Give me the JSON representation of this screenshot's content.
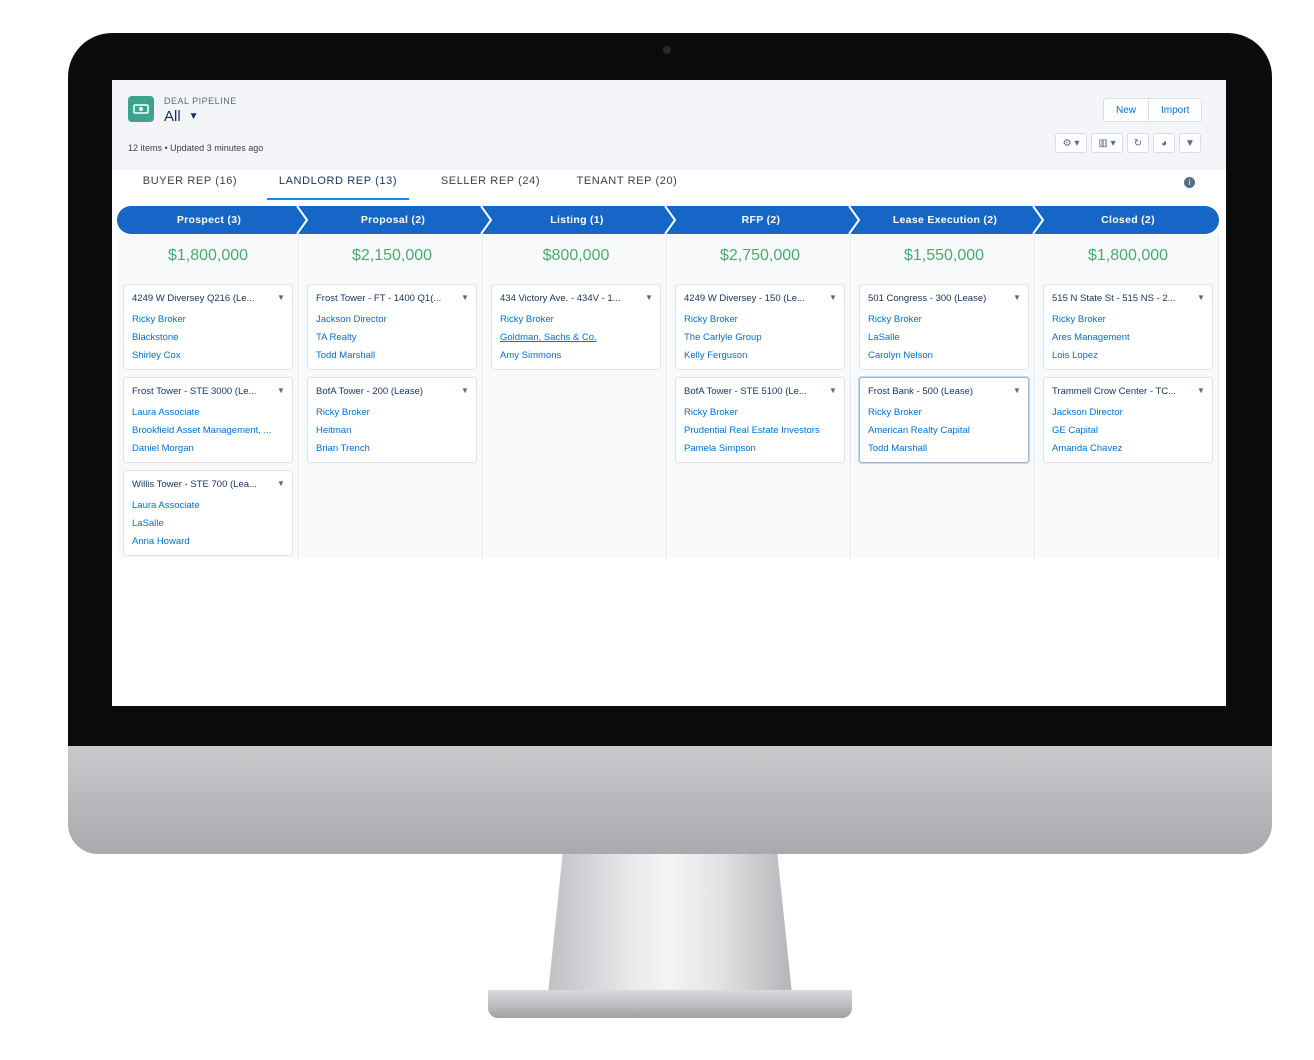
{
  "header": {
    "object_label": "DEAL PIPELINE",
    "list_name": "All",
    "meta": "12 items • Updated 3 minutes ago",
    "buttons": {
      "new": "New",
      "import": "Import"
    },
    "toolbar": {
      "settings_icon": "gear-icon",
      "display_icon": "kanban-icon",
      "refresh_icon": "refresh-icon",
      "chart_icon": "pie-chart-icon",
      "filter_icon": "filter-icon"
    }
  },
  "tabs": [
    {
      "label": "BUYER REP (16)"
    },
    {
      "label": "LANDLORD REP (13)"
    },
    {
      "label": "SELLER REP (24)"
    },
    {
      "label": "TENANT REP (20)"
    }
  ],
  "active_tab_index": 1,
  "stages": [
    {
      "label": "Prospect   (3)",
      "amount": "$1,800,000",
      "cards": [
        {
          "title": "4249 W Diversey Q216 (Le...",
          "l1": "Ricky Broker",
          "l2": "Blackstone",
          "l3": "Shirley Cox"
        },
        {
          "title": "Frost Tower - STE 3000 (Le...",
          "l1": "Laura Associate",
          "l2": "Brookfield Asset Management, ...",
          "l3": "Daniel Morgan"
        },
        {
          "title": "Willis Tower - STE 700 (Lea...",
          "l1": "Laura Associate",
          "l2": "LaSalle",
          "l3": "Anna Howard"
        }
      ]
    },
    {
      "label": "Proposal   (2)",
      "amount": "$2,150,000",
      "cards": [
        {
          "title": "Frost Tower - FT - 1400 Q1(...",
          "l1": "Jackson Director",
          "l2": "TA Realty",
          "l3": "Todd Marshall"
        },
        {
          "title": "BofA Tower - 200 (Lease)",
          "l1": "Ricky Broker",
          "l2": "Heitman",
          "l3": "Brian Trench"
        }
      ]
    },
    {
      "label": "Listing   (1)",
      "amount": "$800,000",
      "cards": [
        {
          "title": "434 Victory Ave. - 434V - 1...",
          "l1": "Ricky Broker",
          "l2": "Goldman, Sachs & Co.",
          "l3": "Amy Simmons"
        }
      ]
    },
    {
      "label": "RFP   (2)",
      "amount": "$2,750,000",
      "cards": [
        {
          "title": "4249 W Diversey - 150 (Le...",
          "l1": "Ricky Broker",
          "l2": "The Carlyle Group",
          "l3": "Kelly Ferguson"
        },
        {
          "title": "BofA Tower - STE 5100 (Le...",
          "l1": "Ricky Broker",
          "l2": "Prudential Real Estate Investors",
          "l3": "Pamela Simpson"
        }
      ]
    },
    {
      "label": "Lease Execution   (2)",
      "amount": "$1,550,000",
      "cards": [
        {
          "title": "501 Congress - 300 (Lease)",
          "l1": "Ricky Broker",
          "l2": "LaSalle",
          "l3": "Carolyn Nelson"
        },
        {
          "title": "Frost Bank - 500 (Lease)",
          "l1": "Ricky Broker",
          "l2": "American Realty Capital",
          "l3": "Todd Marshall"
        }
      ]
    },
    {
      "label": "Closed   (2)",
      "amount": "$1,800,000",
      "cards": [
        {
          "title": "515 N State St - 515 NS - 2...",
          "l1": "Ricky Broker",
          "l2": "Ares Management",
          "l3": "Lois Lopez"
        },
        {
          "title": "Trammell Crow Center - TC...",
          "l1": "Jackson Director",
          "l2": "GE Capital",
          "l3": "Amanda Chavez"
        }
      ]
    }
  ],
  "colors": {
    "path": "#1666c8",
    "amount": "#4bab6a",
    "link": "#0070d2",
    "app_icon": "#3aa48f"
  }
}
